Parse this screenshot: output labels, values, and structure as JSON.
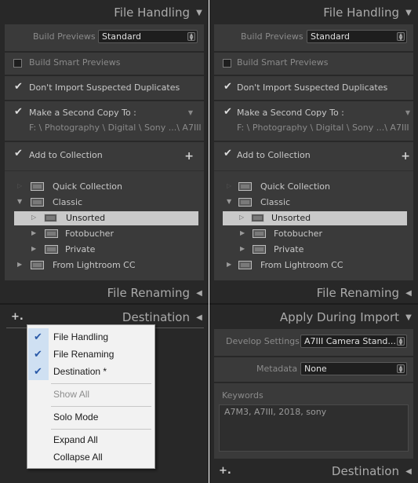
{
  "left": {
    "file_handling": {
      "title": "File Handling",
      "build_previews_label": "Build Previews",
      "build_previews_value": "Standard",
      "build_smart_previews": "Build Smart Previews",
      "dont_import_duplicates": "Don't Import Suspected Duplicates",
      "make_second_copy": "Make a Second Copy To :",
      "second_copy_path": "F: \\ Photography \\ Digital \\ Sony ...\\ A7III",
      "add_to_collection": "Add to Collection",
      "tree": [
        {
          "label": "Quick Collection"
        },
        {
          "label": "Classic"
        },
        {
          "label": "Unsorted"
        },
        {
          "label": "Fotobucher"
        },
        {
          "label": "Private"
        },
        {
          "label": "From Lightroom CC"
        }
      ]
    },
    "file_renaming": {
      "title": "File Renaming"
    },
    "destination": {
      "title": "Destination"
    }
  },
  "menu": {
    "items": [
      {
        "label": "File Handling",
        "checked": true
      },
      {
        "label": "File Renaming",
        "checked": true
      },
      {
        "label": "Destination *",
        "checked": true
      },
      {
        "label": "Show All",
        "disabled": true
      },
      {
        "label": "Solo Mode"
      },
      {
        "label": "Expand All"
      },
      {
        "label": "Collapse All"
      }
    ]
  },
  "right": {
    "file_handling": {
      "title": "File Handling",
      "build_previews_label": "Build Previews",
      "build_previews_value": "Standard",
      "build_smart_previews": "Build Smart Previews",
      "dont_import_duplicates": "Don't Import Suspected Duplicates",
      "make_second_copy": "Make a Second Copy To :",
      "second_copy_path": "F: \\ Photography \\ Digital \\ Sony ...\\ A7III",
      "add_to_collection": "Add to Collection",
      "tree": [
        {
          "label": "Quick Collection"
        },
        {
          "label": "Classic"
        },
        {
          "label": "Unsorted"
        },
        {
          "label": "Fotobucher"
        },
        {
          "label": "Private"
        },
        {
          "label": "From Lightroom CC"
        }
      ]
    },
    "file_renaming": {
      "title": "File Renaming"
    },
    "apply_during_import": {
      "title": "Apply During Import",
      "develop_settings_label": "Develop Settings",
      "develop_settings_value": "A7III Camera Stand...",
      "metadata_label": "Metadata",
      "metadata_value": "None",
      "keywords_label": "Keywords",
      "keywords_value": "A7M3, A7III, 2018, sony"
    },
    "destination": {
      "title": "Destination"
    }
  }
}
